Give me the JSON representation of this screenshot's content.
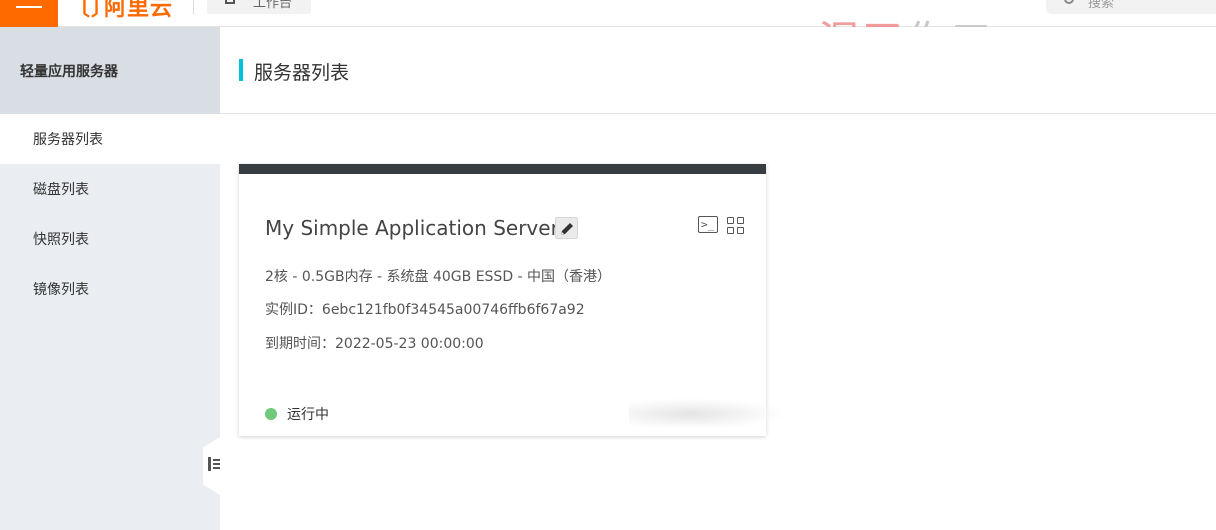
{
  "topbar": {
    "logo_text": "阿里云",
    "workbench_label": "工作台",
    "search_placeholder": "搜索"
  },
  "watermark": {
    "part1": "湿了",
    "part2": "伤口"
  },
  "sidebar": {
    "title": "轻量应用服务器",
    "items": [
      {
        "label": "服务器列表",
        "active": true
      },
      {
        "label": "磁盘列表",
        "active": false
      },
      {
        "label": "快照列表",
        "active": false
      },
      {
        "label": "镜像列表",
        "active": false
      }
    ]
  },
  "main": {
    "title": "服务器列表",
    "server": {
      "name": "My Simple Application Server",
      "spec": "2核 - 0.5GB内存 - 系统盘 40GB ESSD - 中国（香港）",
      "instance_id": "实例ID：6ebc121fb0f34545a00746ffb6f67a92",
      "expiry": "到期时间：2022-05-23 00:00:00",
      "status": "运行中"
    }
  },
  "colors": {
    "brand": "#ff6a00",
    "accent": "#00c1de",
    "status_running": "#6fc978",
    "card_top": "#373d41"
  },
  "icons": [
    "menu-icon",
    "workbench-icon",
    "search-icon",
    "edit-icon",
    "terminal-icon",
    "grid-icon",
    "collapse-sidebar-icon"
  ]
}
